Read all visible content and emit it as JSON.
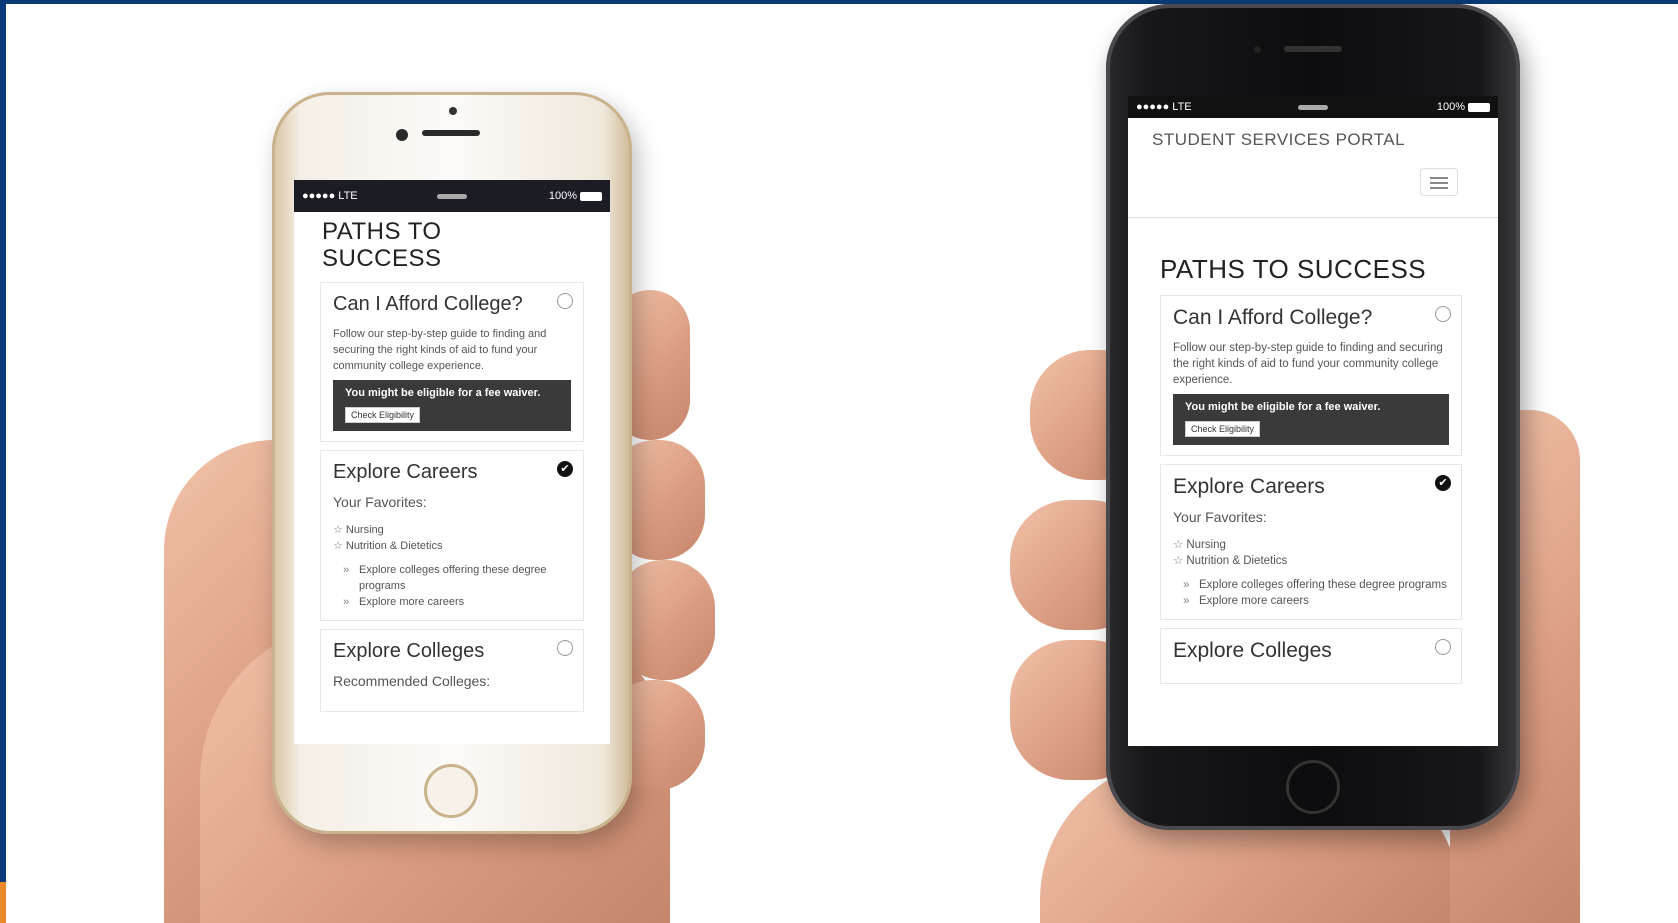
{
  "left_phone": {
    "status": {
      "signal": "●●●●● LTE",
      "battery": "100%"
    },
    "page_title": "PATHS TO SUCCESS",
    "cards": [
      {
        "title": "Can I Afford College?",
        "description": "Follow our step-by-step guide to finding and securing the right kinds of aid to fund your community college experience.",
        "waiver_text": "You might be eligible for a fee waiver.",
        "button_label": "Check Eligibility"
      },
      {
        "title": "Explore Careers",
        "check_glyph": "✔",
        "favorites_label": "Your Favorites:",
        "favorites": [
          "Nursing",
          "Nutrition & Dietetics"
        ],
        "links": [
          "Explore colleges offering these degree programs",
          "Explore more careers"
        ]
      },
      {
        "title": "Explore Colleges",
        "subtitle": "Recommended Colleges:"
      }
    ]
  },
  "right_phone": {
    "status": {
      "signal": "●●●●● LTE",
      "battery": "100%"
    },
    "brand": "STUDENT SERVICES PORTAL",
    "page_title": "PATHS TO SUCCESS",
    "cards": [
      {
        "title": "Can I Afford College?",
        "description": "Follow our step-by-step guide to finding and securing the right kinds of aid to fund your community college experience.",
        "waiver_text": "You might be eligible for a fee waiver.",
        "button_label": "Check Eligibility"
      },
      {
        "title": "Explore Careers",
        "check_glyph": "✔",
        "favorites_label": "Your Favorites:",
        "favorites": [
          "Nursing",
          "Nutrition & Dietetics"
        ],
        "links": [
          "Explore colleges offering these degree programs",
          "Explore more careers"
        ]
      },
      {
        "title": "Explore Colleges"
      }
    ]
  },
  "glyphs": {
    "star": "☆",
    "chevron": "»"
  }
}
